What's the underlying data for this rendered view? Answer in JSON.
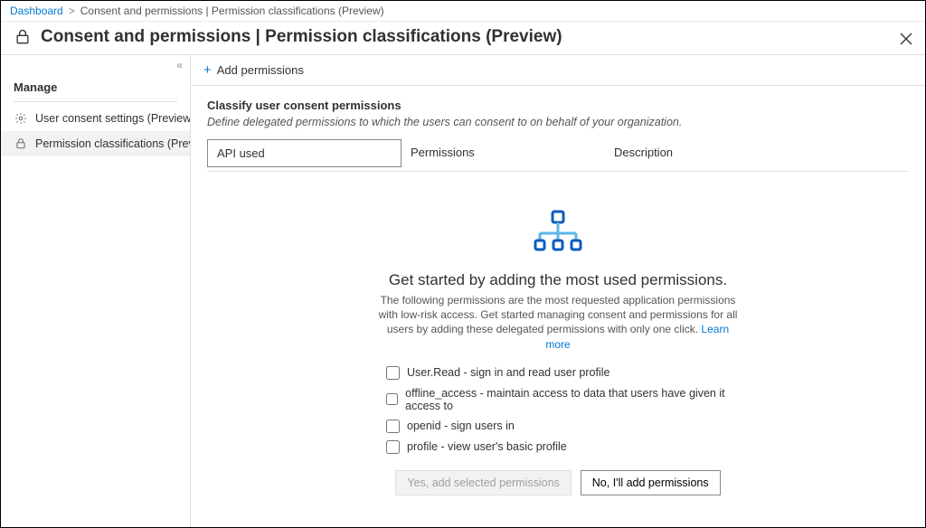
{
  "breadcrumb": {
    "root": "Dashboard",
    "current": "Consent and permissions | Permission classifications (Preview)"
  },
  "title": "Consent and permissions | Permission classifications (Preview)",
  "sidebar": {
    "section": "Manage",
    "items": [
      {
        "label": "User consent settings (Preview)",
        "icon": "gear-icon",
        "selected": false
      },
      {
        "label": "Permission classifications (Previ...",
        "icon": "lock-icon",
        "selected": true
      }
    ]
  },
  "cmdbar": {
    "add": "Add permissions"
  },
  "section": {
    "heading": "Classify user consent permissions",
    "subtitle": "Define delegated permissions to which the users can consent to on behalf of your organization."
  },
  "columns": {
    "api": "API used",
    "perm": "Permissions",
    "desc": "Description"
  },
  "empty": {
    "headline": "Get started by adding the most used permissions.",
    "blurb": "The following permissions are the most requested application permissions with low-risk access. Get started managing consent and permissions for all users by adding these delegated permissions with only one click.",
    "learn": "Learn more",
    "checks": [
      "User.Read - sign in and read user profile",
      "offline_access - maintain access to data that users have given it access to",
      "openid - sign users in",
      "profile - view user's basic profile"
    ],
    "buttons": {
      "yes": "Yes, add selected permissions",
      "no": "No, I'll add permissions"
    }
  }
}
